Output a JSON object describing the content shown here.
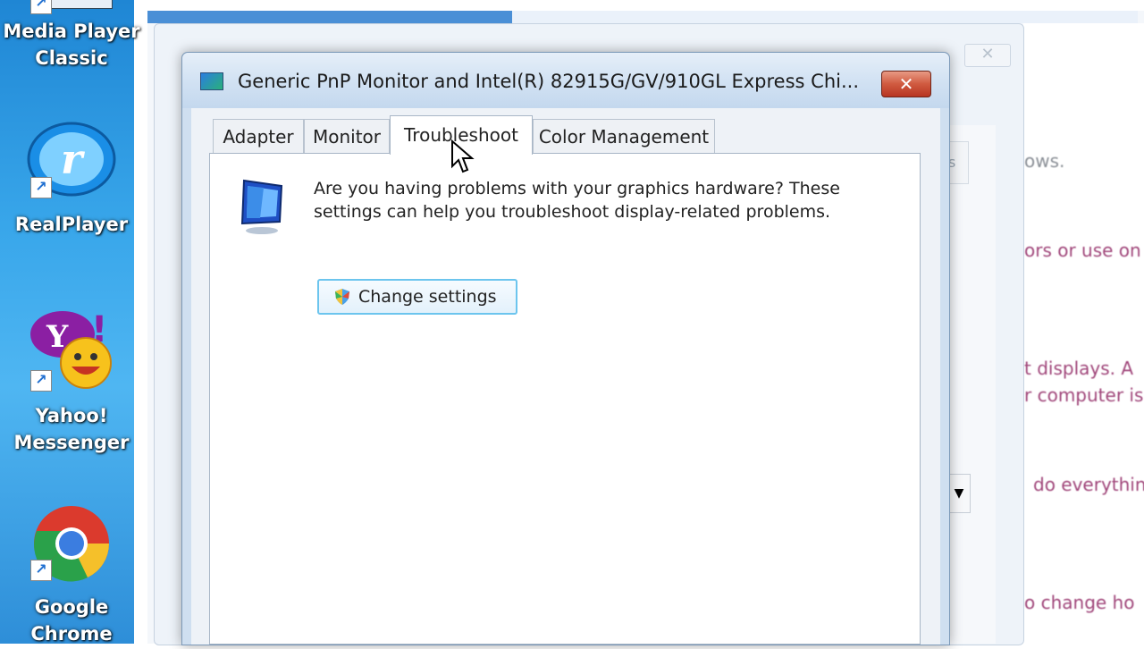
{
  "desktop": {
    "icons": [
      {
        "label_line1": "Media Player",
        "label_line2": "Classic"
      },
      {
        "label_line1": "RealPlayer",
        "label_line2": ""
      },
      {
        "label_line1": "Yahoo!",
        "label_line2": "Messenger"
      },
      {
        "label_line1": "Google",
        "label_line2": "Chrome"
      }
    ]
  },
  "background": {
    "texts": [
      "ows.",
      "ors or use on",
      "t displays. A",
      "r computer is",
      "do everythin",
      "o change ho"
    ]
  },
  "dialog": {
    "title": "Generic PnP Monitor and Intel(R) 82915G/GV/910GL Express Chi...",
    "close_label": "✕",
    "tabs": [
      {
        "label": "Adapter",
        "active": false
      },
      {
        "label": "Monitor",
        "active": false
      },
      {
        "label": "Troubleshoot",
        "active": true
      },
      {
        "label": "Color Management",
        "active": false
      }
    ],
    "description": "Are you having problems with your graphics hardware? These settings can help you troubleshoot display-related problems.",
    "change_settings_label": "Change settings"
  },
  "colors": {
    "accent": "#6cc5ee",
    "close_red": "#c8462e",
    "background_text_pink": "#b04c86"
  },
  "icons": [
    "monitor-icon",
    "shield-icon",
    "close-icon",
    "cursor-icon",
    "shortcut-arrow-icon"
  ]
}
